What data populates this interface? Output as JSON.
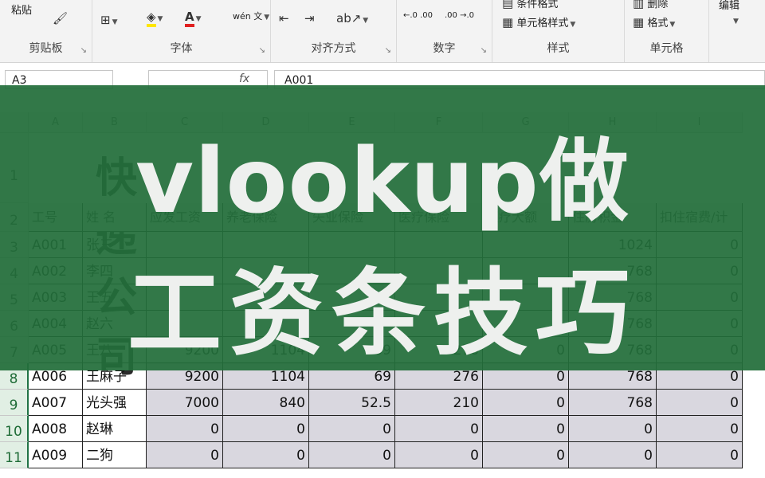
{
  "ribbon": {
    "clipboard": {
      "paste_label": "粘贴",
      "group_label": "剪贴板"
    },
    "font": {
      "group_label": "字体",
      "fill_icon": "fill-color-icon",
      "font_color_icon": "font-color-icon",
      "font_color_letter": "A",
      "phonetic_label": "wén 文"
    },
    "alignment": {
      "group_label": "对齐方式"
    },
    "number": {
      "group_label": "数字",
      "inc_decimal": "←.0 .00",
      "dec_decimal": ".00 →.0"
    },
    "styles": {
      "group_label": "样式",
      "conditional_label": "条件格式",
      "cell_style_label": "单元格样式"
    },
    "cells": {
      "group_label": "单元格",
      "delete_label": "删除",
      "format_label": "格式"
    },
    "editing": {
      "label": "编辑"
    }
  },
  "formula_bar": {
    "name_box": "A3",
    "fx_label": "fx",
    "formula": "A001"
  },
  "sheet": {
    "columns": [
      "A",
      "B",
      "C",
      "D",
      "E",
      "F",
      "G",
      "H",
      "I"
    ],
    "title": "快递公司",
    "headers": [
      "工号",
      "姓 名",
      "应发工资",
      "养老保险",
      "失业保险",
      "医疗保险",
      "医疗大额",
      "住房积金",
      "扣住宿费/计"
    ],
    "rows": [
      {
        "num": "3",
        "cells": [
          "A001",
          "张三",
          "",
          "",
          "",
          "",
          "",
          "1024",
          "0"
        ]
      },
      {
        "num": "4",
        "cells": [
          "A002",
          "李四",
          "",
          "",
          "",
          "",
          "",
          "768",
          "0"
        ]
      },
      {
        "num": "5",
        "cells": [
          "A003",
          "王五",
          "",
          "",
          "",
          "",
          "",
          "768",
          "0"
        ]
      },
      {
        "num": "6",
        "cells": [
          "A004",
          "赵六",
          "",
          "",
          "",
          "",
          "",
          "768",
          "0"
        ]
      },
      {
        "num": "7",
        "cells": [
          "A005",
          "王八",
          "9200",
          "1104",
          "69",
          "276",
          "0",
          "768",
          "0"
        ]
      },
      {
        "num": "8",
        "cells": [
          "A006",
          "王麻子",
          "9200",
          "1104",
          "69",
          "276",
          "0",
          "768",
          "0"
        ]
      },
      {
        "num": "9",
        "cells": [
          "A007",
          "光头强",
          "7000",
          "840",
          "52.5",
          "210",
          "0",
          "768",
          "0"
        ]
      },
      {
        "num": "10",
        "cells": [
          "A008",
          "赵琳",
          "0",
          "0",
          "0",
          "0",
          "0",
          "0",
          "0"
        ]
      },
      {
        "num": "11",
        "cells": [
          "A009",
          "二狗",
          "0",
          "0",
          "0",
          "0",
          "0",
          "0",
          "0"
        ]
      }
    ],
    "header_row_nums": [
      "1",
      "2"
    ]
  },
  "banner": {
    "line1": "vlookup做",
    "line2": "工资条技巧",
    "color": "#226e3a"
  }
}
